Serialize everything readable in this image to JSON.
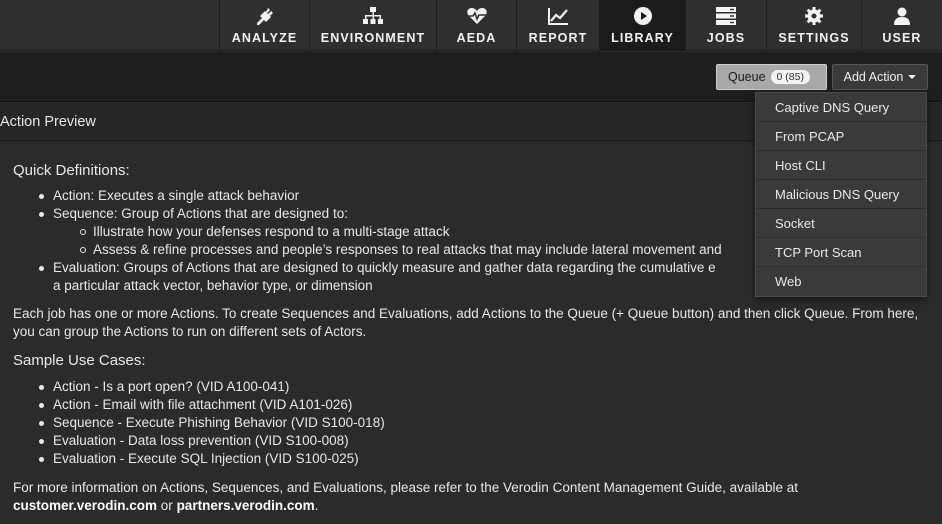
{
  "nav": {
    "items": [
      {
        "label": "ANALYZE",
        "icon": "plug-icon"
      },
      {
        "label": "ENVIRONMENT",
        "icon": "sitemap-icon"
      },
      {
        "label": "AEDA",
        "icon": "heartbeat-icon"
      },
      {
        "label": "REPORT",
        "icon": "line-chart-icon"
      },
      {
        "label": "LIBRARY",
        "icon": "play-circle-icon"
      },
      {
        "label": "JOBS",
        "icon": "server-icon"
      },
      {
        "label": "SETTINGS",
        "icon": "gear-icon"
      },
      {
        "label": "USER",
        "icon": "user-icon"
      }
    ],
    "active": "LIBRARY"
  },
  "toolbar": {
    "queue_label": "Queue",
    "queue_count": "0 (85)",
    "add_action_label": "Add Action"
  },
  "dropdown": {
    "items": [
      "Captive DNS Query",
      "From PCAP",
      "Host CLI",
      "Malicious DNS Query",
      "Socket",
      "TCP Port Scan",
      "Web"
    ]
  },
  "panel": {
    "title": "Action Preview",
    "quick_heading": "Quick Definitions:",
    "action_def": "Action: Executes a single attack behavior",
    "sequence_def": "Sequence: Group of Actions that are designed to:",
    "sequence_sub1": "Illustrate how your defenses respond to a multi-stage attack",
    "sequence_sub2": "Assess & refine processes and people’s responses to real attacks that may include lateral movement and",
    "evaluation_def_1": "Evaluation: Groups of Actions that are designed to quickly measure and gather data regarding the cumulative e",
    "evaluation_def_2": "a particular attack vector, behavior type, or dimension",
    "para1": "Each job has one or more Actions. To create Sequences and Evaluations, add Actions to the Queue (+ Queue button) and then click Queue. From here, you can group the Actions to run on different sets of Actors.",
    "sample_heading": "Sample Use Cases:",
    "samples": [
      "Action - Is a port open? (VID A100-041)",
      "Action - Email with file attachment (VID A101-026)",
      "Sequence - Execute Phishing Behavior (VID S100-018)",
      "Evaluation - Data loss prevention (VID S100-008)",
      "Evaluation - Execute SQL Injection (VID S100-025)"
    ],
    "para2_text": "For more information on Actions, Sequences, and Evaluations, please refer to the Verodin Content Management Guide, available at",
    "link1": "customer.verodin.com",
    "or_text": " or ",
    "link2": "partners.verodin.com",
    "period": "."
  }
}
